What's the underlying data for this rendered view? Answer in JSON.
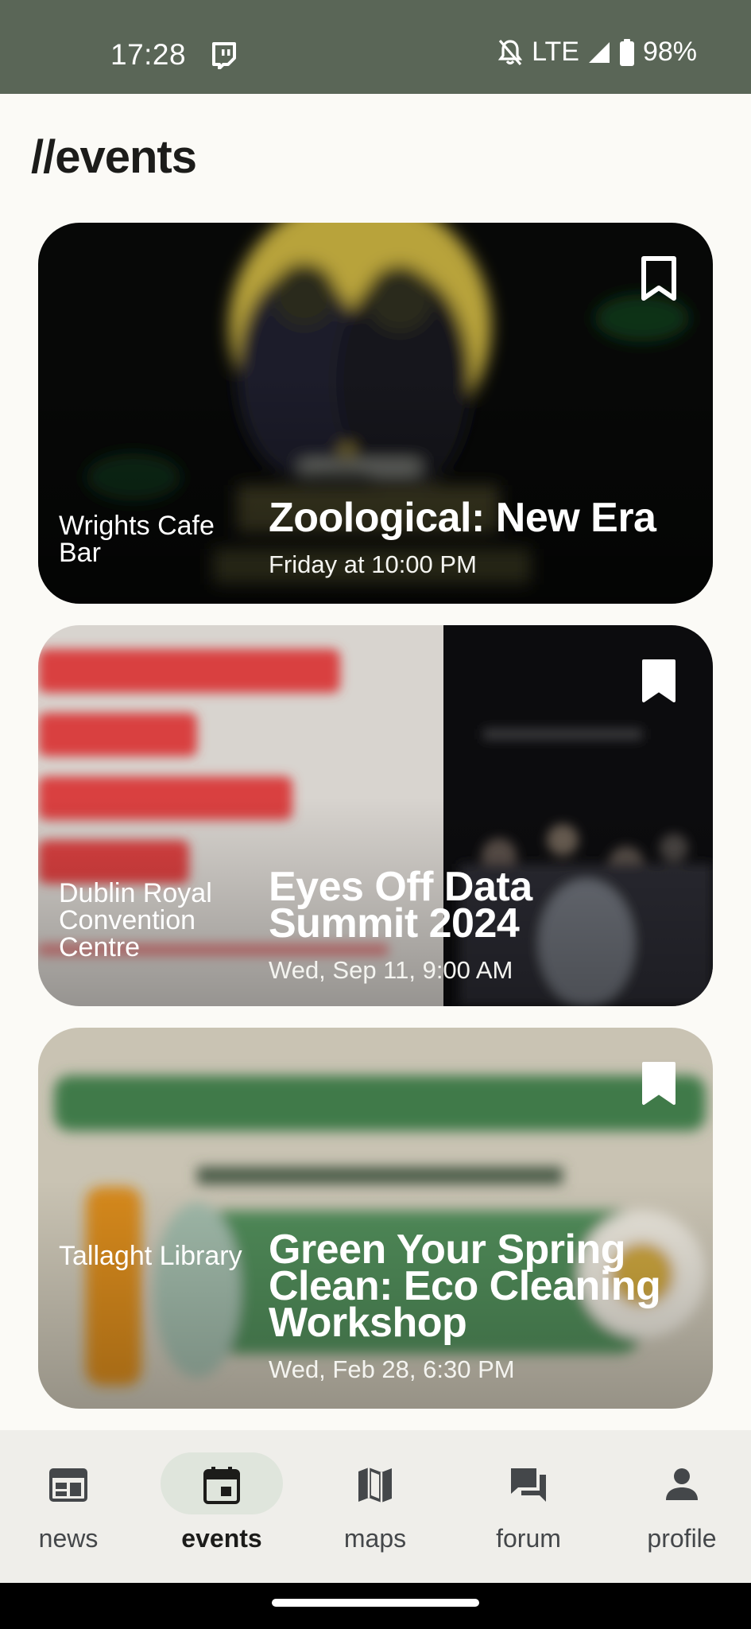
{
  "status_bar": {
    "time": "17:28",
    "network": "LTE",
    "battery": "98%"
  },
  "page": {
    "title": "//events"
  },
  "events": [
    {
      "venue": "Wrights Cafe Bar",
      "title": "Zoological: New Era",
      "date": "Friday at 10:00 PM",
      "bookmarked": false
    },
    {
      "venue": "Dublin Royal Convention Centre",
      "title": "Eyes Off Data Summit 2024",
      "date": "Wed, Sep 11, 9:00 AM",
      "bookmarked": true
    },
    {
      "venue": "Tallaght Library",
      "title": "Green Your Spring Clean: Eco Cleaning Workshop",
      "date": "Wed, Feb 28, 6:30 PM",
      "bookmarked": true
    }
  ],
  "nav": {
    "items": [
      {
        "label": "news",
        "icon": "news-icon",
        "active": false
      },
      {
        "label": "events",
        "icon": "calendar-icon",
        "active": true
      },
      {
        "label": "maps",
        "icon": "map-icon",
        "active": false
      },
      {
        "label": "forum",
        "icon": "forum-icon",
        "active": false
      },
      {
        "label": "profile",
        "icon": "person-icon",
        "active": false
      }
    ]
  },
  "colors": {
    "status_bar": "#5a6657",
    "background": "#fbfaf6",
    "nav_background": "#efeeea",
    "nav_active_pill": "#dfe5dc"
  }
}
